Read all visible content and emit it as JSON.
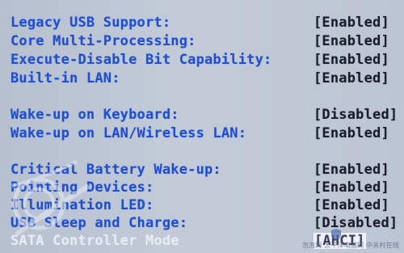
{
  "settings": [
    {
      "label": "Legacy USB Support:",
      "value": "[Enabled]"
    },
    {
      "label": "Core Multi-Processing:",
      "value": "[Enabled]"
    },
    {
      "label": "Execute-Disable Bit Capability:",
      "value": "[Enabled]"
    },
    {
      "label": "Built-in LAN:",
      "value": "[Enabled]"
    },
    {
      "label": "Wake-up on Keyboard:",
      "value": "[Disabled]"
    },
    {
      "label": "Wake-up on LAN/Wireless LAN:",
      "value": "[Enabled]"
    },
    {
      "label": "Critical Battery Wake-up:",
      "value": "[Enabled]"
    },
    {
      "label": "Pointing Devices:",
      "value": "[Enabled]"
    },
    {
      "label": "Illumination LED:",
      "value": "[Enabled]"
    },
    {
      "label": "USB Sleep and Charge:",
      "value": "[Disabled]"
    },
    {
      "label": "SATA Controller Mode",
      "value": "[AHCI]"
    }
  ],
  "watermark": {
    "text": "泡泡网 太平洋电脑网 中关村在线",
    "logo_text": "太平洋"
  },
  "colors": {
    "label": "#1f4fd0",
    "value": "#1a1d2c",
    "background": "#bcc5d3",
    "highlight_label": "#e7ebf2",
    "highlight_value_bg": "#eef1f6"
  }
}
